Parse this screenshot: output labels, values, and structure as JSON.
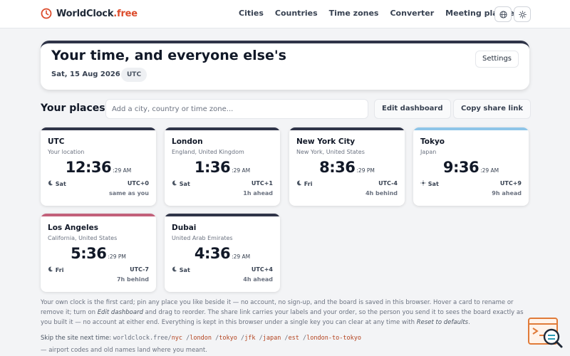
{
  "brand": {
    "name": "WorldClock",
    "suffix": ".free"
  },
  "nav": [
    "Cities",
    "Countries",
    "Time zones",
    "Converter",
    "Meeting planner"
  ],
  "header_icons": [
    "globe-icon",
    "sun-icon"
  ],
  "hero": {
    "title": "Your time, and everyone else's",
    "date": "Sat, 15 Aug 2026",
    "tz": "UTC",
    "settings": "Settings"
  },
  "places": {
    "label": "Your places",
    "placeholder": "Add a city, country or time zone...",
    "edit": "Edit dashboard",
    "share": "Copy share link"
  },
  "cards": [
    {
      "city": "UTC",
      "region": "Your location",
      "time": "12:36",
      "sec": ":29 AM",
      "day": "Sat",
      "day_icon": "moon-icon",
      "offset": "UTC+0",
      "diff": "same as you",
      "accent": "#2f3448"
    },
    {
      "city": "London",
      "region": "England, United Kingdom",
      "time": "1:36",
      "sec": ":29 AM",
      "day": "Sat",
      "day_icon": "moon-icon",
      "offset": "UTC+1",
      "diff": "1h ahead",
      "accent": "#2f3448"
    },
    {
      "city": "New York City",
      "region": "New York, United States",
      "time": "8:36",
      "sec": ":29 PM",
      "day": "Fri",
      "day_icon": "moon-icon",
      "offset": "UTC-4",
      "diff": "4h behind",
      "accent": "#2f3448"
    },
    {
      "city": "Tokyo",
      "region": "Japan",
      "time": "9:36",
      "sec": ":29 AM",
      "day": "Sat",
      "day_icon": "sun-icon",
      "offset": "UTC+9",
      "diff": "9h ahead",
      "accent": "#8ec5e8"
    },
    {
      "city": "Los Angeles",
      "region": "California, United States",
      "time": "5:36",
      "sec": ":29 PM",
      "day": "Fri",
      "day_icon": "moon-icon",
      "offset": "UTC-7",
      "diff": "7h behind",
      "accent": "#c2607a"
    },
    {
      "city": "Dubai",
      "region": "United Arab Emirates",
      "time": "4:36",
      "sec": ":29 AM",
      "day": "Sat",
      "day_icon": "moon-icon",
      "offset": "UTC+4",
      "diff": "4h ahead",
      "accent": "#2f3448"
    }
  ],
  "note": {
    "p1": "Your own clock is the first card; pin any place you like beside it — no account, no sign-up, and the board is saved in this browser. Hover a card to rename or remove it; turn on ",
    "em1": "Edit dashboard",
    "p2": " and drag to reorder. The share link carries your labels and your order, so the person you send it to sees the board exactly as you built it — no account at either end. Everything is kept in this browser under a single key you can clear at any time with ",
    "em2": "Reset to defaults",
    "p3": "."
  },
  "skip": {
    "label": "Skip the site next time:",
    "host": "worldclock.free/",
    "paths": [
      "nyc",
      "london",
      "tokyo",
      "jfk",
      "japan",
      "est",
      "london-to-tokyo"
    ],
    "sep": " /"
  },
  "tail": "— airport codes and old names land where you meant."
}
